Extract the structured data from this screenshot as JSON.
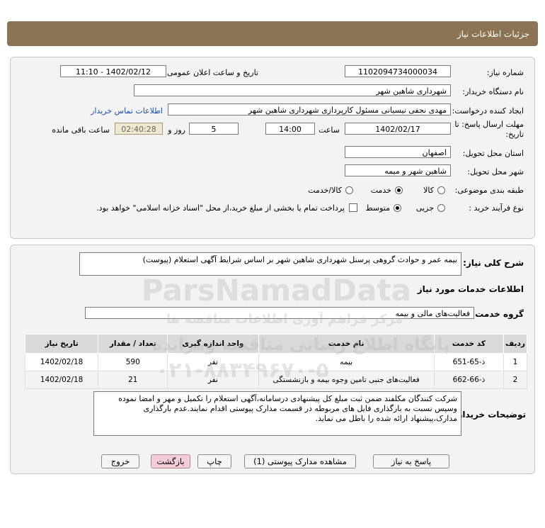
{
  "header": {
    "title": "جزئیات اطلاعات نیاز"
  },
  "form": {
    "need_number_label": "شماره نیاز:",
    "need_number": "1102094734000034",
    "announce_label": "تاریخ و ساعت اعلان عمومی:",
    "announce_value": "1402/02/12 - 11:10",
    "buyer_label": "نام دستگاه خریدار:",
    "buyer_value": "شهرداری شاهین شهر",
    "creator_label": "ایجاد کننده درخواست:",
    "creator_value": "مهدی نجفی نیسیانی مسئول کارپردازی شهرداری شاهین شهر",
    "contact_link": "اطلاعات تماس خریدار",
    "deadline_label_1": "مهلت ارسال پاسخ: تا",
    "deadline_label_2": "تاریخ:",
    "deadline_date": "1402/02/17",
    "time_label": "ساعت",
    "deadline_time": "14:00",
    "days_value": "5",
    "days_label": "روز و",
    "remaining_time": "02:40:28",
    "remaining_label": "ساعت باقی مانده",
    "province_label": "استان محل تحویل:",
    "province_value": "اصفهان",
    "city_label": "شهر محل تحویل:",
    "city_value": "شاهین شهر و میمه",
    "category_label": "طبقه بندی موضوعی:",
    "category_options": [
      "کالا",
      "خدمت",
      "کالا/خدمت"
    ],
    "category_selected": "خدمت",
    "process_label": "نوع فرآیند خرید :",
    "process_options": [
      "جزیی",
      "متوسط"
    ],
    "process_selected": "متوسط",
    "payment_note": "پرداخت تمام یا بخشی از مبلغ خرید،از محل \"اسناد خزانه اسلامی\" خواهد بود."
  },
  "details": {
    "summary_label": "شرح کلی نیاز:",
    "summary_value": "بیمه عمر و حوادث گروهی پرسنل شهرداری شاهین شهر بر اساس شرایط آگهی استعلام (پیوست)",
    "services_heading": "اطلاعات خدمات مورد نیاز",
    "service_group_label": "گروه خدمت:",
    "service_group_value": "فعالیت‌های مالی و بیمه",
    "table": {
      "headers": [
        "ردیف",
        "کد خدمت",
        "نام خدمت",
        "واحد اندازه گیری",
        "تعداد / مقدار",
        "تاریخ نیاز"
      ],
      "rows": [
        [
          "1",
          "ذ-65-651",
          "بیمه",
          "نفر",
          "590",
          "1402/02/18"
        ],
        [
          "2",
          "ذ-66-662",
          "فعالیت‌های جنبی تامین وجوه بیمه و بازنشستگی",
          "نفر",
          "21",
          "1402/02/18"
        ]
      ]
    },
    "notes_label": "توضیحات خریدار:",
    "notes_value": "شرکت کنندگان مکلفند ضمن ثبت مبلغ کل پیشنهادی درسامانه،آگهی استعلام را  تکمیل و مهر و امضا نموده وسپس نسبت به بارگذاری فایل های مربوطه در قسمت مدارک پیوستی اقدام نمایند.عدم بارگذاری مدارک،پیشنهاد ارائه شده را باطل می نماید."
  },
  "buttons": {
    "reply": "پاسخ به نیاز",
    "view_docs": "مشاهده مدارک پیوستی (1)",
    "print": "چاپ",
    "back": "بازگشت",
    "exit": "خروج"
  },
  "watermark": {
    "brand": "ParsNamadData",
    "line1": "مرکز فراهم آوری اطلاعات مناقصه ها",
    "line2": "پایگاه اطلاع رسانی مناقصه ومزایده",
    "phone": "۰۲۱-۸۸۳۴۹۶۷۰-۵"
  },
  "colors": {
    "title_bar": "#8b7353",
    "panel_bg": "#f3f3f3",
    "link": "#1a4fb0",
    "exit_button": "#f4cdd6"
  }
}
